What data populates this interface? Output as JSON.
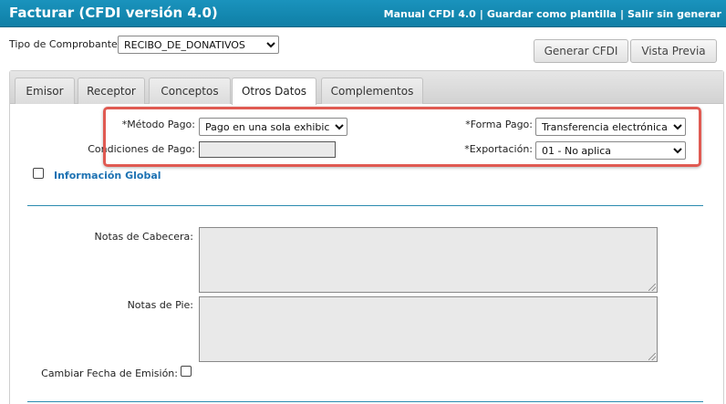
{
  "header": {
    "title": "Facturar (CFDI versión 4.0)",
    "links": [
      "Manual CFDI 4.0",
      "Guardar como plantilla",
      "Salir sin generar"
    ],
    "separator": "|",
    "bg_color": "#1287b3"
  },
  "tipo_comprobante": {
    "label": "Tipo de Comprobante:",
    "value": "RECIBO_DE_DONATIVOS"
  },
  "buttons": {
    "generar": "Generar CFDI",
    "vista_previa": "Vista Previa"
  },
  "tabs": [
    {
      "label": "Emisor",
      "active": false
    },
    {
      "label": "Receptor",
      "active": false
    },
    {
      "label": "Conceptos",
      "active": false
    },
    {
      "label": "Otros Datos",
      "active": true
    },
    {
      "label": "Complementos",
      "active": false
    }
  ],
  "form": {
    "metodo_pago": {
      "label": "*Método Pago:",
      "value": "Pago en una sola exhibición"
    },
    "forma_pago": {
      "label": "*Forma Pago:",
      "value": "Transferencia electrónica de fondos"
    },
    "condiciones_pago": {
      "label": "Condiciones de Pago:",
      "value": ""
    },
    "exportacion": {
      "label": "*Exportación:",
      "value": "01 - No aplica"
    },
    "informacion_global": {
      "label": "Información Global",
      "checked": false
    },
    "notas_cabecera": {
      "label": "Notas de Cabecera:",
      "value": ""
    },
    "notas_pie": {
      "label": "Notas de Pie:",
      "value": ""
    },
    "cambiar_fecha": {
      "label": "Cambiar Fecha de Emisión:",
      "checked": false
    }
  },
  "highlight_color": "#e05a52"
}
